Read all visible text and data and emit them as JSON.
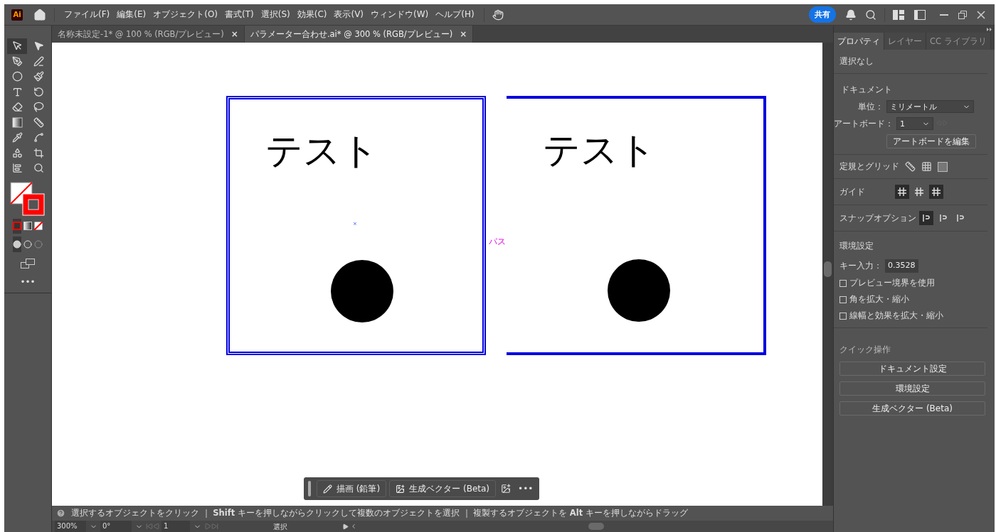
{
  "app": {
    "logo": "Ai"
  },
  "menu": [
    "ファイル(F)",
    "編集(E)",
    "オブジェクト(O)",
    "書式(T)",
    "選択(S)",
    "効果(C)",
    "表示(V)",
    "ウィンドウ(W)",
    "ヘルプ(H)"
  ],
  "share_button": "共有",
  "doc_tabs": [
    {
      "title": "名称未設定-1* @ 100 % (RGB/プレビュー)",
      "close": "×",
      "selected": false
    },
    {
      "title": "パラメーター合わせ.ai* @ 300 % (RGB/プレビュー)",
      "close": "×",
      "selected": true
    }
  ],
  "canvas": {
    "artboards": [
      {
        "text": "テスト",
        "kind": "double"
      },
      {
        "text": "テスト",
        "kind": "open"
      }
    ],
    "center_mark": "×",
    "path_label": "パス"
  },
  "panel": {
    "tabs": [
      {
        "label": "プロパティ",
        "selected": true
      },
      {
        "label": "レイヤー",
        "selected": false
      },
      {
        "label": "CC ライブラリ",
        "selected": false
      }
    ],
    "selection": "選択なし",
    "document": {
      "heading": "ドキュメント",
      "unit_label": "単位：",
      "unit": "ミリメートル",
      "artboard_label": "アートボード：",
      "artboard": "1",
      "edit_button": "アートボードを編集"
    },
    "rulers_grid": "定規とグリッド",
    "guides": {
      "label": "ガイド",
      "toggles": [
        {
          "selected": true
        },
        {
          "selected": false
        },
        {
          "selected": true
        }
      ]
    },
    "snap": {
      "label": "スナップオプション",
      "toggles": [
        {
          "selected": true
        },
        {
          "selected": false
        },
        {
          "selected": false
        }
      ]
    },
    "prefs": {
      "heading": "環境設定",
      "key_label": "キー入力：",
      "key_value": "0.3528",
      "checkboxes": [
        {
          "label": "プレビュー境界を使用",
          "checked": false
        },
        {
          "label": "角を拡大・縮小",
          "checked": false
        },
        {
          "label": "線幅と効果を拡大・縮小",
          "checked": false
        }
      ]
    },
    "quick": {
      "heading": "クイック操作",
      "buttons": [
        "ドキュメント設定",
        "環境設定",
        "生成ベクター (Beta)"
      ]
    }
  },
  "float_bar": {
    "buttons": [
      "描画 (鉛筆)",
      "生成ベクター (Beta)"
    ],
    "more": "•••"
  },
  "status": {
    "hint": "選択するオブジェクトをクリック ｜ **Shift** キーを押しながらクリックして複数のオブジェクトを選択 ｜ 複製するオブジェクトを **Alt** キーを押しながらドラッグ",
    "zoom": "300%",
    "rotation": "0°",
    "artboard": "1",
    "tool": "選択"
  },
  "toolbar": {
    "more": "•••"
  }
}
